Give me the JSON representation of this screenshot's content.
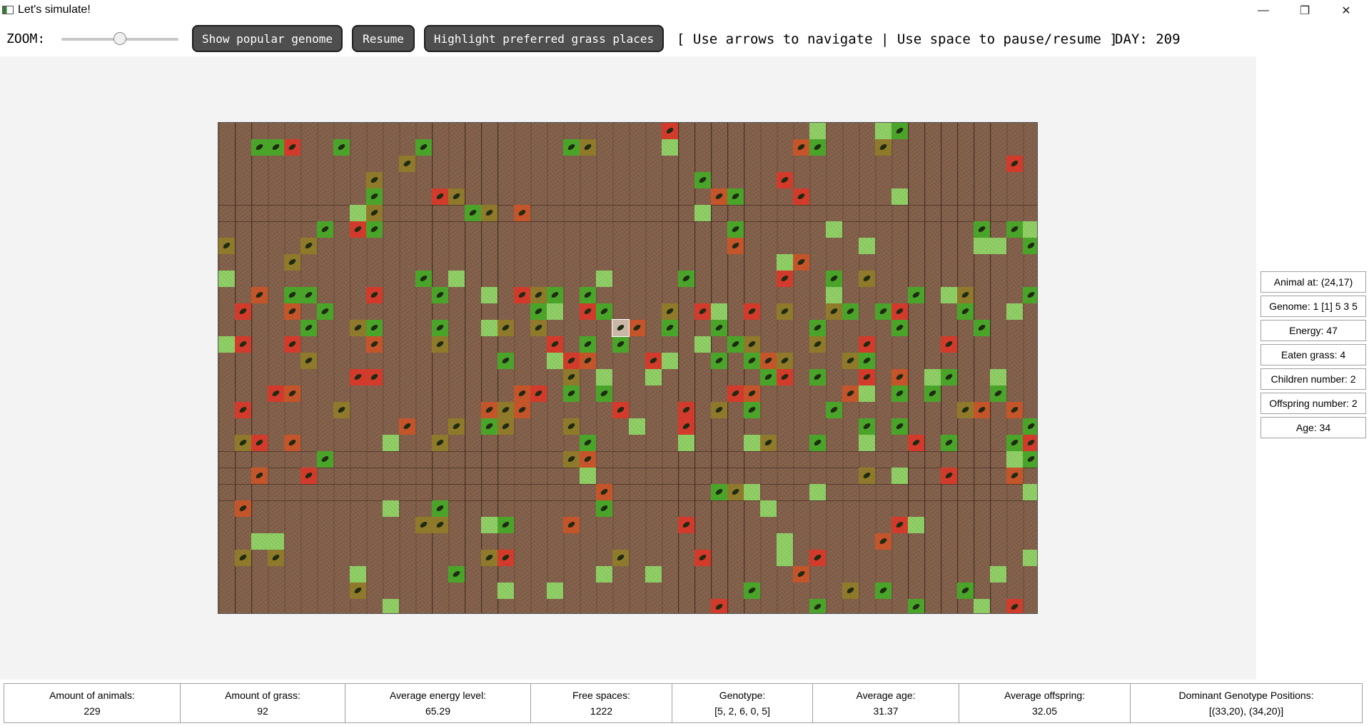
{
  "window": {
    "title": "Let's simulate!",
    "controls": [
      "—",
      "❐",
      "✕"
    ]
  },
  "toolbar": {
    "zoom_label": "ZOOM:",
    "zoom_value": 0.5,
    "show_genome_label": "Show popular genome",
    "resume_label": "Resume",
    "highlight_label": "Highlight preferred grass places",
    "help_text": "[ Use arrows to navigate | Use space to pause/resume ]",
    "day_text": "DAY: 209"
  },
  "colors": {
    "dirt": "#83604a",
    "grass": "#86c85a",
    "animal_healthy": "#4aa42a",
    "animal_medium": "#8e7a2a",
    "animal_low": "#c4542a",
    "animal_critical": "#d23b2b",
    "animal_selected": "#c9b8a8"
  },
  "animal_info": {
    "position": "Animal at: (24,17)",
    "genome": "Genome: 1 [1] 5 3 5",
    "energy": "Energy: 47",
    "eaten_grass": "Eaten grass: 4",
    "children": "Children number: 2",
    "offspring": "Offspring number: 2",
    "age": "Age: 34"
  },
  "stats": [
    {
      "label": "Amount of animals:",
      "value": "229"
    },
    {
      "label": "Amount of grass:",
      "value": "92"
    },
    {
      "label": "Average energy level:",
      "value": "65.29"
    },
    {
      "label": "Free spaces:",
      "value": "1222"
    },
    {
      "label": "Genotype:",
      "value": "[5, 2, 6, 0, 5]"
    },
    {
      "label": "Average age:",
      "value": "31.37"
    },
    {
      "label": "Average offspring:",
      "value": "32.05"
    },
    {
      "label": "Dominant Genotype Positions:",
      "value": "[(33,20), (34,20)]"
    }
  ]
}
